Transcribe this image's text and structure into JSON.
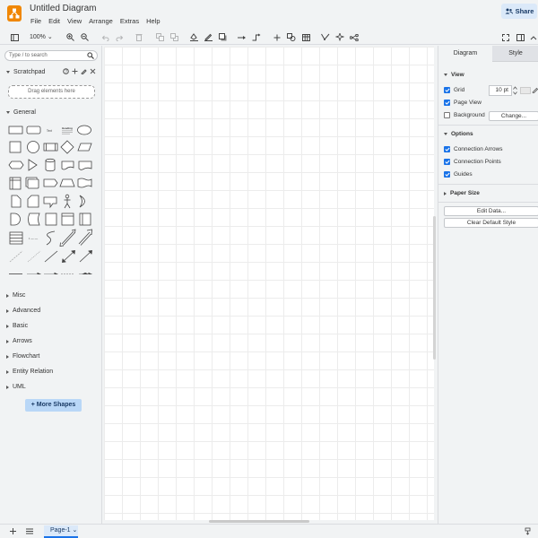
{
  "app": {
    "title": "Untitled Diagram",
    "menu": [
      "File",
      "Edit",
      "View",
      "Arrange",
      "Extras",
      "Help"
    ],
    "share_label": "Share",
    "accent_color": "#f08705"
  },
  "toolbar": {
    "zoom": "100%",
    "icons": [
      "sidebar-toggle-icon",
      "zoom-in-icon",
      "zoom-out-icon",
      "undo-icon",
      "redo-icon",
      "delete-icon",
      "to-front-icon",
      "to-back-icon",
      "fill-color-icon",
      "line-color-icon",
      "shadow-icon",
      "connection-icon",
      "waypoints-icon",
      "insert-icon",
      "shapes-icon",
      "table-icon",
      "draw-icon",
      "ai-icon",
      "layout-icon",
      "fullscreen-icon",
      "format-panel-icon",
      "collapse-icon"
    ]
  },
  "sidebar": {
    "search_placeholder": "Type / to search",
    "scratchpad_label": "Scratchpad",
    "dropzone_text": "Drag elements here",
    "general_label": "General",
    "text_sample": "Text",
    "heading_sample": "Heading",
    "sections": [
      "Misc",
      "Advanced",
      "Basic",
      "Arrows",
      "Flowchart",
      "Entity Relation",
      "UML"
    ],
    "more_shapes_label": "More Shapes"
  },
  "format_panel": {
    "tabs": [
      "Diagram",
      "Style"
    ],
    "view_label": "View",
    "grid_label": "Grid",
    "grid_checked": true,
    "grid_size": "10 pt",
    "page_view_label": "Page View",
    "page_view_checked": true,
    "background_label": "Background",
    "background_checked": false,
    "change_label": "Change...",
    "options_label": "Options",
    "connection_arrows_label": "Connection Arrows",
    "connection_arrows_checked": true,
    "connection_points_label": "Connection Points",
    "connection_points_checked": true,
    "guides_label": "Guides",
    "guides_checked": true,
    "paper_size_label": "Paper Size",
    "edit_data_label": "Edit Data...",
    "clear_style_label": "Clear Default Style"
  },
  "footer": {
    "page_name": "Page-1"
  }
}
